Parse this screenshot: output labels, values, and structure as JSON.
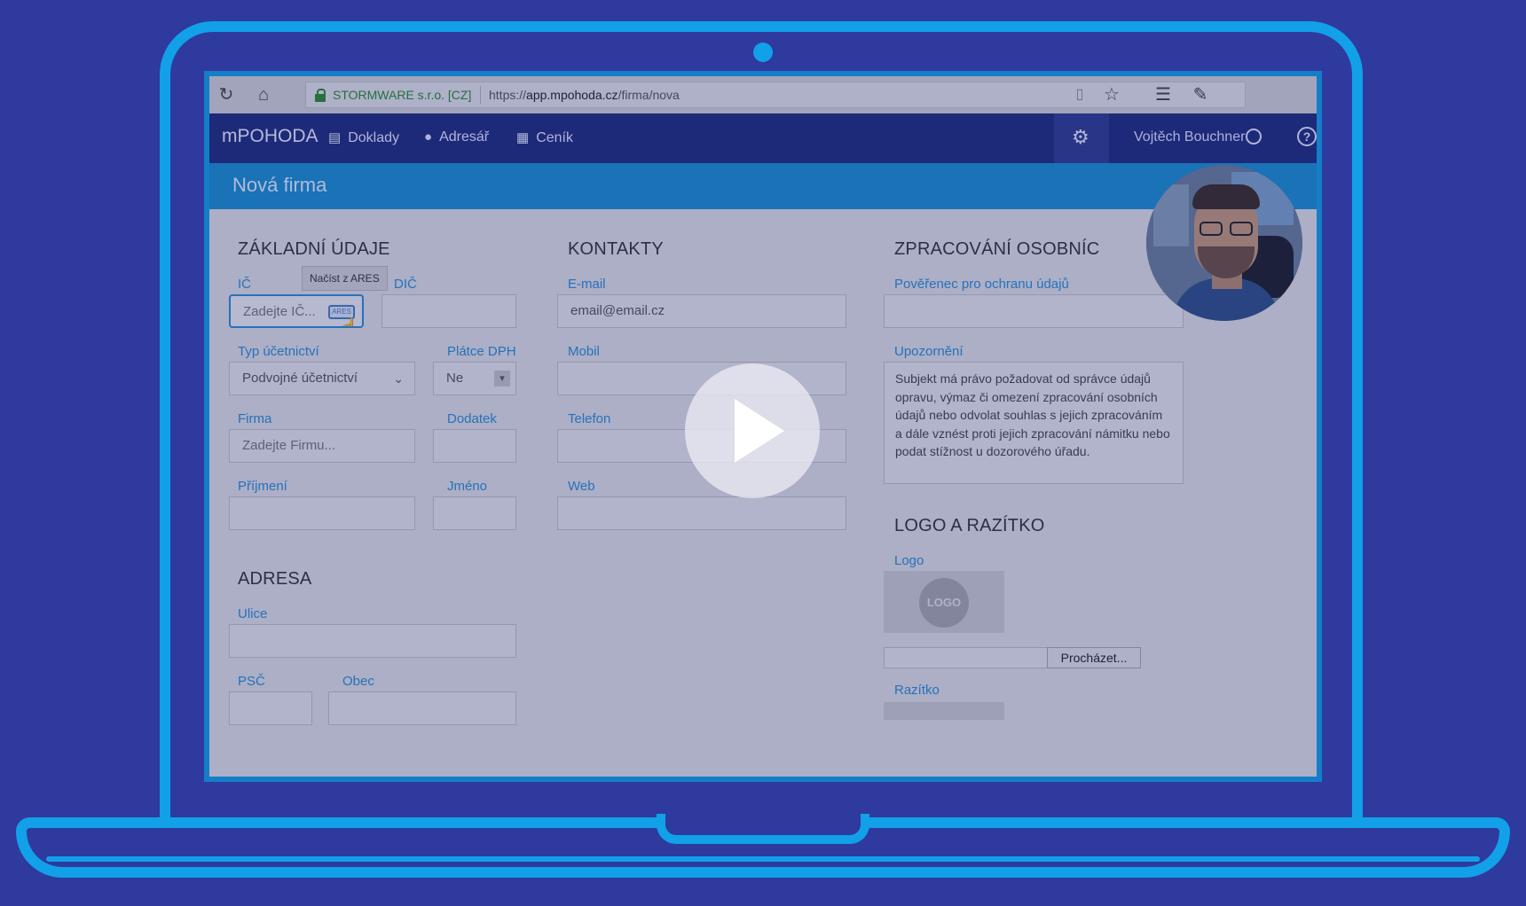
{
  "browser": {
    "site_identity": "STORMWARE s.r.o. [CZ]",
    "url_prefix": "https://",
    "url_host": "app.mpohoda.cz",
    "url_path": "/firma/nova"
  },
  "header": {
    "app_name": "mPOHODA",
    "nav": [
      {
        "label": "Doklady",
        "icon": "documents-icon"
      },
      {
        "label": "Adresář",
        "icon": "person-icon"
      },
      {
        "label": "Ceník",
        "icon": "clipboard-icon"
      }
    ],
    "user_name": "Vojtěch Bouchner"
  },
  "page_title": "Nová firma",
  "basic": {
    "heading": "ZÁKLADNÍ ÚDAJE",
    "ic_label": "IČ",
    "ares_tooltip": "Načíst z ARES",
    "ares_button": "ARES",
    "ic_placeholder": "Zadejte IČ...",
    "dic_label": "DIČ",
    "typ_label": "Typ účetnictví",
    "typ_value": "Podvojné účetnictví",
    "platce_label": "Plátce DPH",
    "platce_value": "Ne",
    "firma_label": "Firma",
    "firma_placeholder": "Zadejte Firmu...",
    "dodatek_label": "Dodatek",
    "prijmeni_label": "Příjmení",
    "jmeno_label": "Jméno"
  },
  "address": {
    "heading": "ADRESA",
    "ulice_label": "Ulice",
    "psc_label": "PSČ",
    "obec_label": "Obec"
  },
  "contacts": {
    "heading": "KONTAKTY",
    "email_label": "E-mail",
    "email_value": "email@email.cz",
    "mobil_label": "Mobil",
    "telefon_label": "Telefon",
    "web_label": "Web"
  },
  "privacy": {
    "heading": "ZPRACOVÁNÍ OSOBNÍC",
    "poverenec_label": "Pověřenec pro ochranu údajů",
    "upozorneni_label": "Upozornění",
    "notice_text": "Subjekt má právo požadovat od správce údajů opravu, výmaz či omezení zpracování osobních údajů nebo odvolat souhlas s jejich zpracováním a dále vznést proti jejich zpracování námitku nebo podat stížnost u dozorového úřadu."
  },
  "logo": {
    "heading": "LOGO A RAZÍTKO",
    "logo_label": "Logo",
    "logo_placeholder": "LOGO",
    "browse_button": "Procházet...",
    "razitko_label": "Razítko"
  },
  "colors": {
    "frame": "#12a0e8",
    "background": "#2e3a9e",
    "header": "#1e2b7a",
    "title_bar": "#1a8fd0",
    "label": "#2b8ed6"
  }
}
